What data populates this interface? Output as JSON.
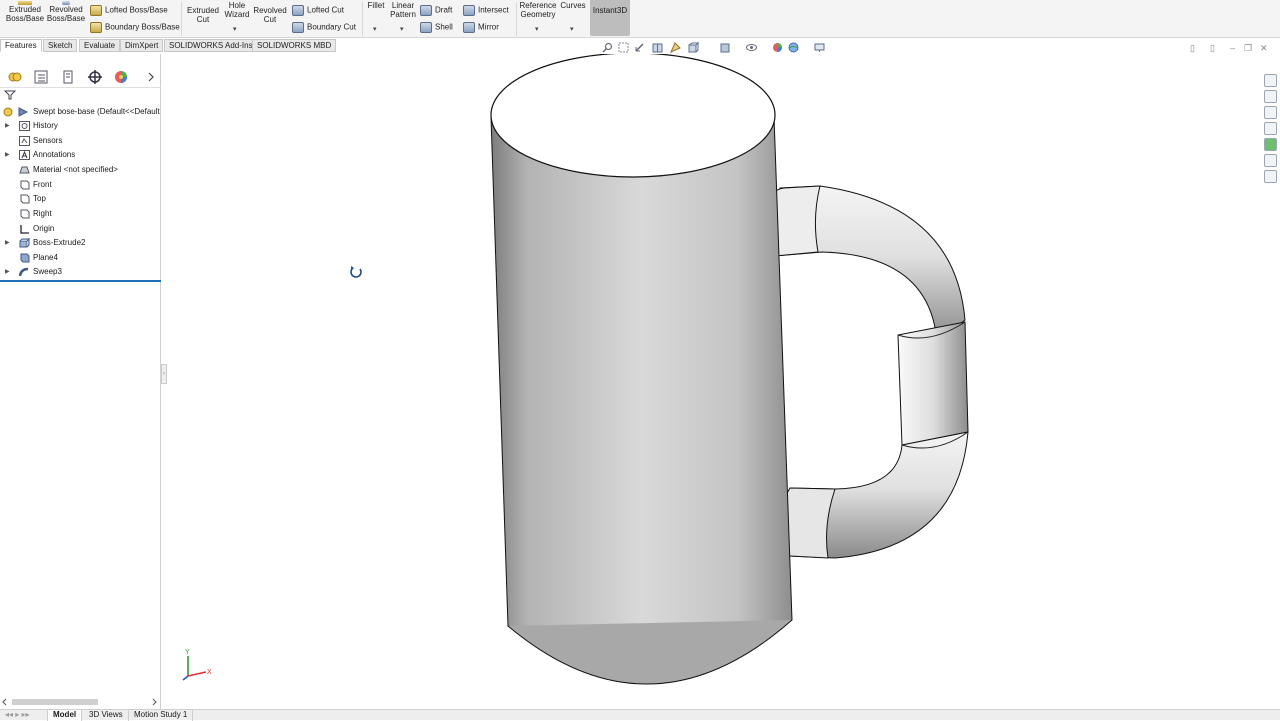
{
  "ribbon": {
    "extruded_boss": "Extruded Boss/Base",
    "revolved_boss": "Revolved Boss/Base",
    "lofted_boss": "Lofted Boss/Base",
    "boundary_boss": "Boundary Boss/Base",
    "extruded_cut": "Extruded Cut",
    "hole_wizard": "Hole Wizard",
    "revolved_cut": "Revolved Cut",
    "lofted_cut": "Lofted Cut",
    "boundary_cut": "Boundary Cut",
    "fillet": "Fillet",
    "linear_pattern": "Linear Pattern",
    "draft": "Draft",
    "shell": "Shell",
    "intersect": "Intersect",
    "mirror": "Mirror",
    "reference_geometry": "Reference Geometry",
    "curves": "Curves",
    "instant3d": "Instant3D"
  },
  "tabs": [
    "Features",
    "Sketch",
    "Evaluate",
    "DimXpert",
    "SOLIDWORKS Add-Ins",
    "SOLIDWORKS MBD"
  ],
  "tree": {
    "root": "Swept bose-base  (Default<<Default",
    "items": [
      "History",
      "Sensors",
      "Annotations",
      "Material <not specified>",
      "Front",
      "Top",
      "Right",
      "Origin",
      "Boss-Extrude2",
      "Plane4",
      "Sweep3"
    ]
  },
  "bottom_tabs": [
    "Model",
    "3D Views",
    "Motion Study 1"
  ],
  "triad": {
    "y": "Y",
    "x": "X"
  },
  "colors": {
    "active_tab": "#ffffff",
    "rollback_bar": "#1f6fb5",
    "instant3d_bg": "#bdbdbd"
  },
  "icons": [
    "search-icon",
    "zoom-area-icon",
    "previous-view-icon",
    "section-view-icon",
    "view-orientation-icon",
    "display-style-icon",
    "hide-show-icon",
    "edit-appearance-icon",
    "scene-icon",
    "view-settings-icon",
    "home-icon",
    "3d-parts-icon",
    "file-explorer-icon",
    "view-palette-icon",
    "appearances-icon",
    "custom-properties-icon",
    "forum-icon"
  ]
}
